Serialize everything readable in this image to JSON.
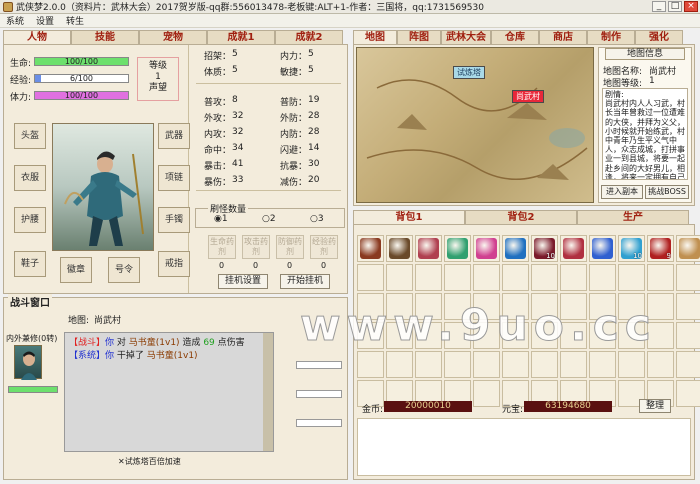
{
  "window": {
    "title": "武侠梦2.0.0（资料片：武林大会）2017贺岁版-qq群:556013478-老板键:ALT+1-作者：三国将，qq:1731569530"
  },
  "menu": [
    "系统",
    "设置",
    "转生"
  ],
  "left_tabs": [
    "人物",
    "技能",
    "宠物",
    "成就1",
    "成就2"
  ],
  "character": {
    "hp_label": "生命:",
    "hp_text": "100/100",
    "hp_pct": 100,
    "exp_label": "经验:",
    "exp_text": "6/100",
    "exp_pct": 6,
    "mp_label": "体力:",
    "mp_text": "100/100",
    "mp_pct": 100,
    "level_label": "等级",
    "level_value": "1",
    "prestige_label": "声望",
    "equip": [
      "头盔",
      "衣服",
      "护腰",
      "鞋子",
      "徽章",
      "号令",
      "武器",
      "项链",
      "手镯",
      "戒指"
    ]
  },
  "stats": [
    [
      "招架：",
      "5",
      "内力：",
      "5"
    ],
    [
      "体质：",
      "5",
      "敏捷：",
      "5"
    ],
    [
      "普攻：",
      "8",
      "普防：",
      "19"
    ],
    [
      "外攻：",
      "32",
      "外防：",
      "28"
    ],
    [
      "内攻：",
      "32",
      "内防：",
      "28"
    ],
    [
      "命中：",
      "34",
      "闪避：",
      "14"
    ],
    [
      "暴击：",
      "41",
      "抗暴：",
      "30"
    ],
    [
      "暴伤：",
      "33",
      "减伤：",
      "20"
    ]
  ],
  "dungeon": {
    "label": "刷怪数量",
    "options": [
      "1",
      "2",
      "3"
    ],
    "selected": "1",
    "potions": [
      "生命药剂",
      "攻击药剂",
      "防御药剂",
      "经验药剂"
    ],
    "potion_counts": [
      "0",
      "0",
      "0",
      "0"
    ],
    "hang_setting": "挂机设置",
    "start_hang": "开始挂机"
  },
  "right_tabs": [
    "地图",
    "阵图",
    "武林大会",
    "仓库",
    "商店",
    "制作",
    "强化"
  ],
  "map": {
    "tag1": "试炼塔",
    "tag2": "尚武村",
    "info_title": "地图信息",
    "name_label": "地图名称:",
    "name_value": "尚武村",
    "level_label": "地图等级:",
    "level_value": "1",
    "desc": "剧情:\n尚武村内人人习武，村长当年曾救过一位遭难的大侠，并拜为义父，小时候就开始练武，村中青年乃生平义气中人，众志成城，打拼事业一到县城，将要一起赴乡间的大好男儿，相逢，将来一定拥有自己的大业。",
    "enter_dungeon": "进入副本",
    "challenge_boss": "挑战BOSS"
  },
  "bag": {
    "tabs": [
      "背包1",
      "背包2",
      "生产"
    ],
    "items": [
      {
        "color": "#8a3a20",
        "count": ""
      },
      {
        "color": "#6a4a2a",
        "count": ""
      },
      {
        "color": "#b04050",
        "count": ""
      },
      {
        "color": "#30a070",
        "count": ""
      },
      {
        "color": "#d04090",
        "count": ""
      },
      {
        "color": "#2070c0",
        "count": ""
      },
      {
        "color": "#7a1a2a",
        "count": "10"
      },
      {
        "color": "#b03040",
        "count": ""
      },
      {
        "color": "#3060d0",
        "count": ""
      },
      {
        "color": "#30a0d0",
        "count": "10"
      },
      {
        "color": "#b02020",
        "count": "9"
      },
      {
        "color": "#c09050",
        "count": ""
      }
    ],
    "gold_label": "金币:",
    "gold_value": "20000010",
    "ingot_label": "元宝:",
    "ingot_value": "63194680",
    "sort_button": "整理"
  },
  "battle": {
    "title": "战斗窗口",
    "map_label": "地图:",
    "map_value": "尚武村",
    "player_label": "内外兼修(0转)",
    "log": [
      {
        "tag": "【战斗】",
        "who": "你",
        "text": " 对 ",
        "target": "马书童(1v1)",
        "text2": " 造成 ",
        "num": "69",
        "text3": " 点伤害"
      },
      {
        "tag": "【系统】",
        "who": "你",
        "text": " 干掉了 ",
        "target": "马书童(1v1)",
        "text2": "",
        "num": "",
        "text3": ""
      }
    ],
    "checkbox_label": "试炼塔百倍加速"
  },
  "watermark": "www.9uo.cc"
}
